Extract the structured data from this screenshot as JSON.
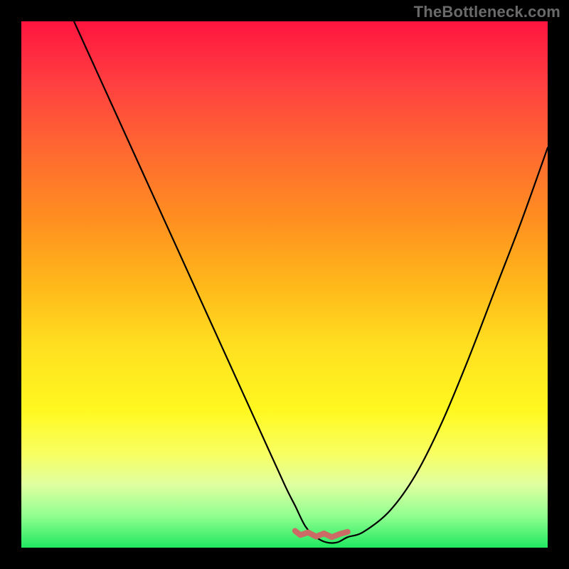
{
  "watermark": "TheBottleneck.com",
  "colors": {
    "frame": "#000000",
    "curve": "#000000",
    "rough_segment": "#cc6a66",
    "gradient_top": "#ff143f",
    "gradient_bottom": "#20e860"
  },
  "chart_data": {
    "type": "line",
    "title": "",
    "xlabel": "",
    "ylabel": "",
    "xlim": [
      0,
      100
    ],
    "ylim": [
      0,
      100
    ],
    "grid": false,
    "legend": false,
    "series": [
      {
        "name": "bottleneck-curve",
        "x": [
          10,
          15,
          20,
          25,
          30,
          35,
          40,
          45,
          50,
          52,
          54,
          56,
          58,
          60,
          62,
          65,
          70,
          75,
          80,
          85,
          90,
          95,
          100
        ],
        "y": [
          100,
          89,
          78,
          67,
          56,
          45,
          34,
          23,
          12,
          8,
          4,
          2,
          1,
          1,
          2,
          3,
          7,
          14,
          24,
          36,
          49,
          62,
          76
        ]
      }
    ],
    "floor_segment": {
      "name": "rough-floor",
      "x": [
        52,
        53,
        54.5,
        56,
        57.5,
        59,
        60.5,
        62
      ],
      "y": [
        3.2,
        2.4,
        2.9,
        2.1,
        2.7,
        2.0,
        2.6,
        3.0
      ]
    }
  }
}
